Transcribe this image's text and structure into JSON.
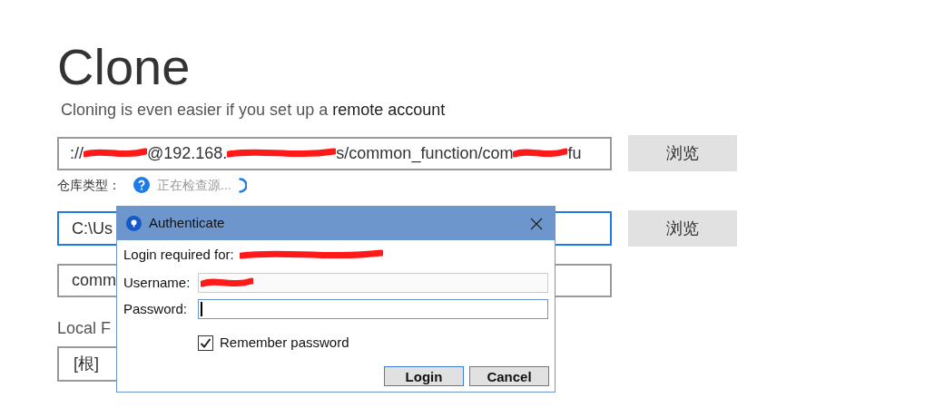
{
  "page": {
    "title": "Clone",
    "subtitle": "Cloning is even easier if you set up a",
    "subtitle_link": "remote account"
  },
  "source": {
    "parts": [
      "://",
      "@192.168.",
      "s/common_function/com",
      "fu"
    ],
    "browse": "浏览"
  },
  "repo_type": {
    "label": "仓库类型：",
    "status": "正在检查源..."
  },
  "destination": {
    "value": "C:\\Us",
    "focused": true,
    "browse": "浏览"
  },
  "name_field": {
    "value": "comm"
  },
  "local_folder": {
    "label": "Local F",
    "value": "[根]"
  },
  "dialog": {
    "title": "Authenticate",
    "login_required": "Login required for:",
    "username_label": "Username:",
    "password_label": "Password:",
    "remember": {
      "label": "Remember password",
      "checked": true
    },
    "buttons": [
      {
        "label": "Login",
        "default": true
      },
      {
        "label": "Cancel",
        "default": false
      }
    ]
  }
}
